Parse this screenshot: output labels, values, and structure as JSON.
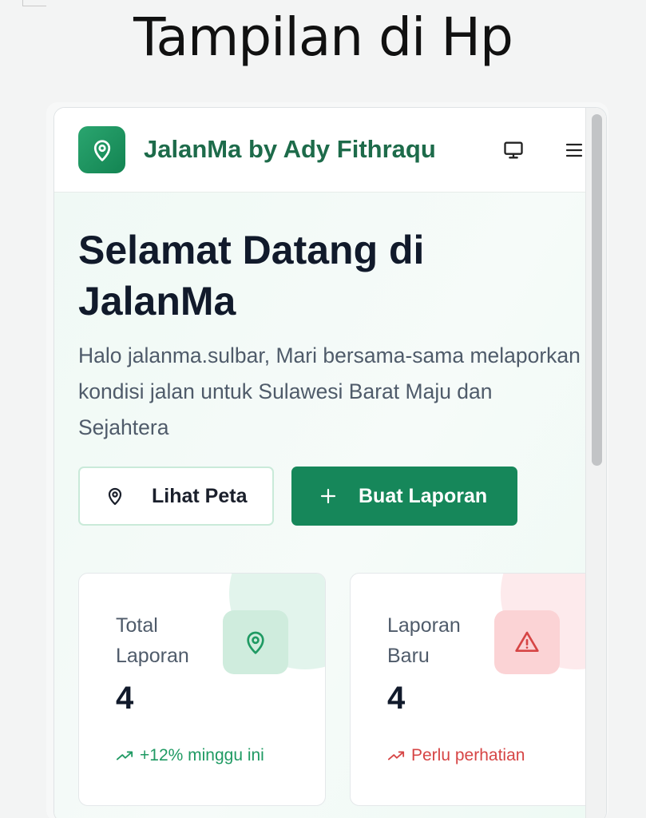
{
  "caption": "Tampilan di Hp",
  "header": {
    "brand": "JalanMa by Ady Fithraqu",
    "icons": [
      "map-pin-icon",
      "monitor-icon",
      "menu-icon"
    ]
  },
  "hero": {
    "title": "Selamat Datang di JalanMa",
    "subtitle": "Halo jalanma.sulbar, Mari bersama-sama melaporkan kondisi jalan untuk Sulawesi Barat Maju dan Sejahtera",
    "btn_map": "Lihat Peta",
    "btn_report": "Buat Laporan"
  },
  "cards": [
    {
      "label": "Total Laporan",
      "value": "4",
      "note": "+12% minggu ini",
      "accent": "#1f9a63",
      "icon": "map-pin-icon"
    },
    {
      "label": "Laporan Baru",
      "value": "4",
      "note": "Perlu perhatian",
      "accent": "#d64545",
      "icon": "warning-icon"
    }
  ],
  "colors": {
    "brand": "#16875a",
    "brand_text": "#1d6b4a",
    "title": "#111a2b",
    "danger": "#d64545"
  }
}
